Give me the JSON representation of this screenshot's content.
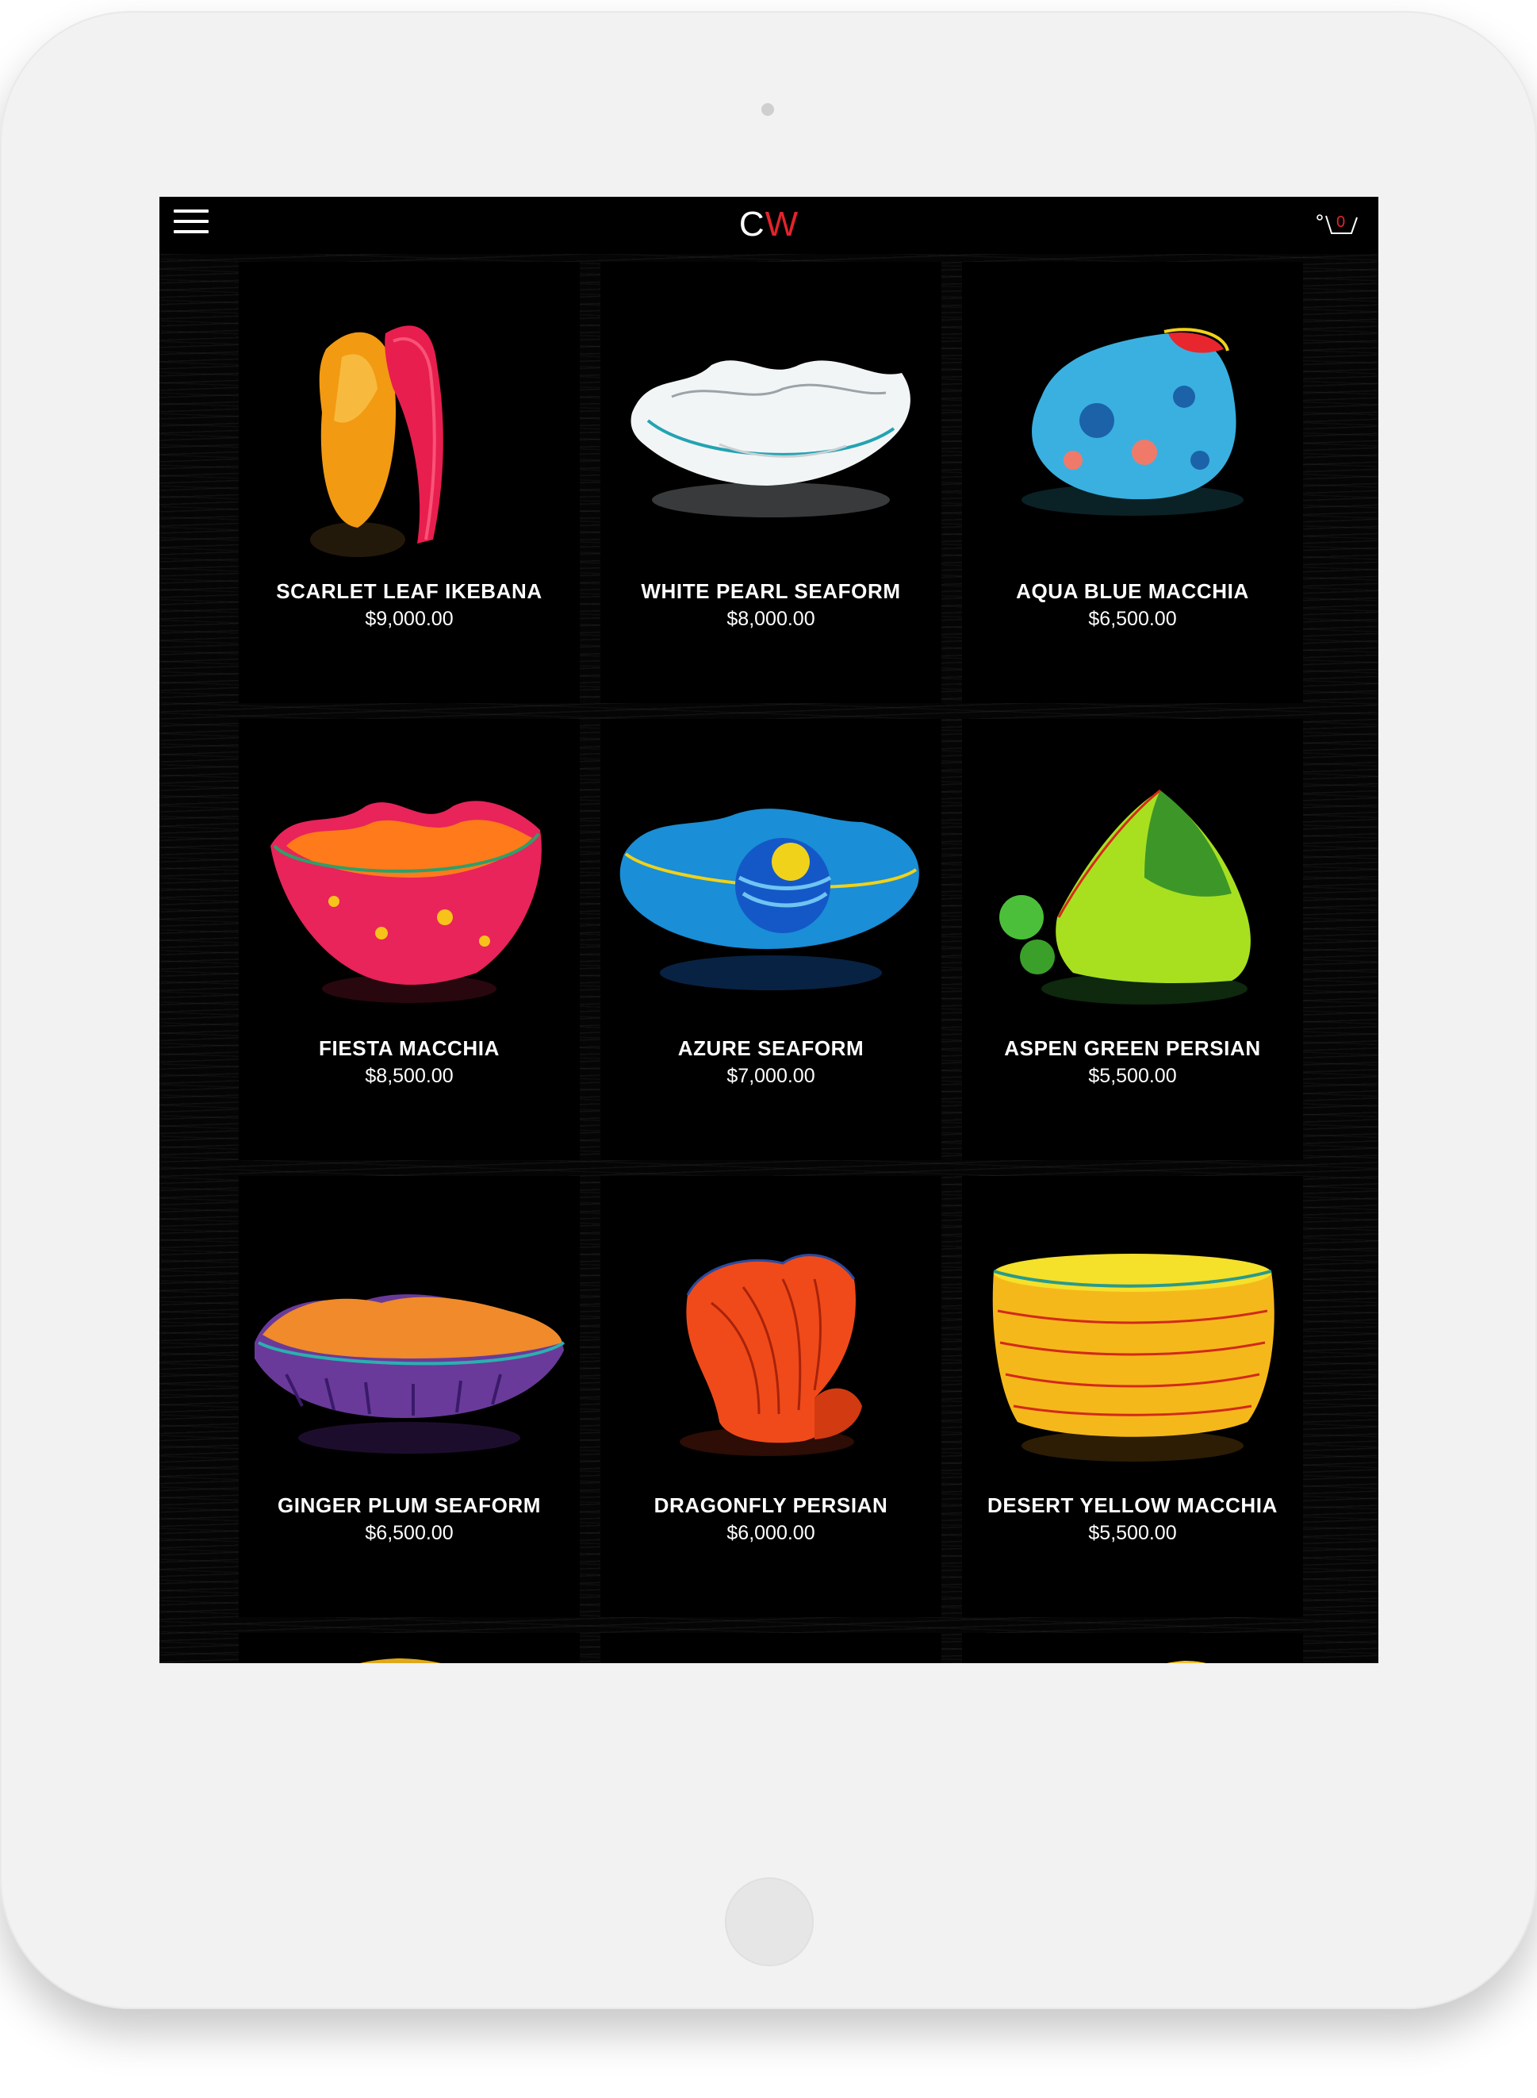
{
  "header": {
    "logo_c": "C",
    "logo_w": "W",
    "cart_count": "0",
    "menu_icon": "hamburger-menu-icon",
    "cart_icon": "shopping-cart-icon"
  },
  "colors": {
    "accent": "#e2242b",
    "background": "#000000",
    "device": "#f2f2f2"
  },
  "products": [
    {
      "name": "SCARLET LEAF IKEBANA",
      "price": "$9,000.00"
    },
    {
      "name": "WHITE PEARL SEAFORM",
      "price": "$8,000.00"
    },
    {
      "name": "AQUA BLUE MACCHIA",
      "price": "$6,500.00"
    },
    {
      "name": "FIESTA MACCHIA",
      "price": "$8,500.00"
    },
    {
      "name": "AZURE SEAFORM",
      "price": "$7,000.00"
    },
    {
      "name": "ASPEN GREEN PERSIAN",
      "price": "$5,500.00"
    },
    {
      "name": "GINGER PLUM SEAFORM",
      "price": "$6,500.00"
    },
    {
      "name": "DRAGONFLY PERSIAN",
      "price": "$6,000.00"
    },
    {
      "name": "DESERT YELLOW MACCHIA",
      "price": "$5,500.00"
    }
  ]
}
